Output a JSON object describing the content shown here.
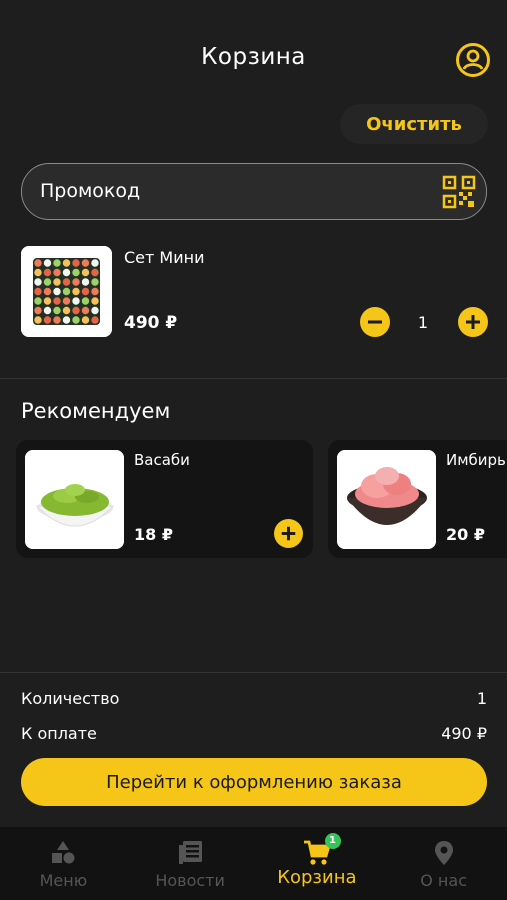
{
  "header": {
    "title": "Корзина",
    "profile_icon": "user-circle-icon"
  },
  "actions": {
    "clear_label": "Очистить"
  },
  "promo": {
    "placeholder": "Промокод",
    "icon": "qr-code-icon"
  },
  "cart": {
    "items": [
      {
        "name": "Сет Мини",
        "price": "490 ₽",
        "quantity": "1"
      }
    ]
  },
  "recommend": {
    "title": "Рекомендуем",
    "items": [
      {
        "name": "Васаби",
        "price": "18 ₽"
      },
      {
        "name": "Имбирь",
        "price": "20 ₽"
      }
    ]
  },
  "summary": {
    "quantity_label": "Количество",
    "quantity_value": "1",
    "total_label": "К оплате",
    "total_value": "490 ₽",
    "checkout_label": "Перейти к оформлению заказа"
  },
  "tabbar": {
    "tabs": [
      {
        "label": "Меню",
        "icon": "shapes-icon"
      },
      {
        "label": "Новости",
        "icon": "newspaper-icon"
      },
      {
        "label": "Корзина",
        "icon": "cart-icon",
        "badge": "1"
      },
      {
        "label": "О нас",
        "icon": "location-pin-icon"
      }
    ]
  },
  "colors": {
    "accent": "#f5c518",
    "background": "#1e1e1e",
    "badge": "#35c45a"
  }
}
